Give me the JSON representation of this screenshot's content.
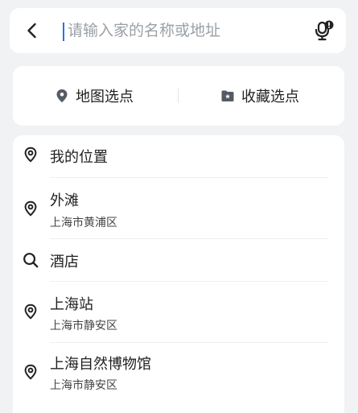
{
  "search": {
    "placeholder": "请输入家的名称或地址",
    "value": ""
  },
  "quick_actions": [
    {
      "label": "地图选点",
      "icon": "location-pin-icon"
    },
    {
      "label": "收藏选点",
      "icon": "bookmark-folder-icon"
    }
  ],
  "places": [
    {
      "title": "我的位置",
      "subtitle": "",
      "icon": "location-pin-icon"
    },
    {
      "title": "外滩",
      "subtitle": "上海市黄浦区",
      "icon": "location-pin-icon"
    },
    {
      "title": "酒店",
      "subtitle": "",
      "icon": "search-icon"
    },
    {
      "title": "上海站",
      "subtitle": "上海市静安区",
      "icon": "location-pin-icon"
    },
    {
      "title": "上海自然博物馆",
      "subtitle": "上海市静安区",
      "icon": "location-pin-icon"
    }
  ],
  "colors": {
    "background": "#f1f2f4",
    "caret": "#2e6cf6",
    "icon": "#222222",
    "quick_icon": "#555b63"
  }
}
